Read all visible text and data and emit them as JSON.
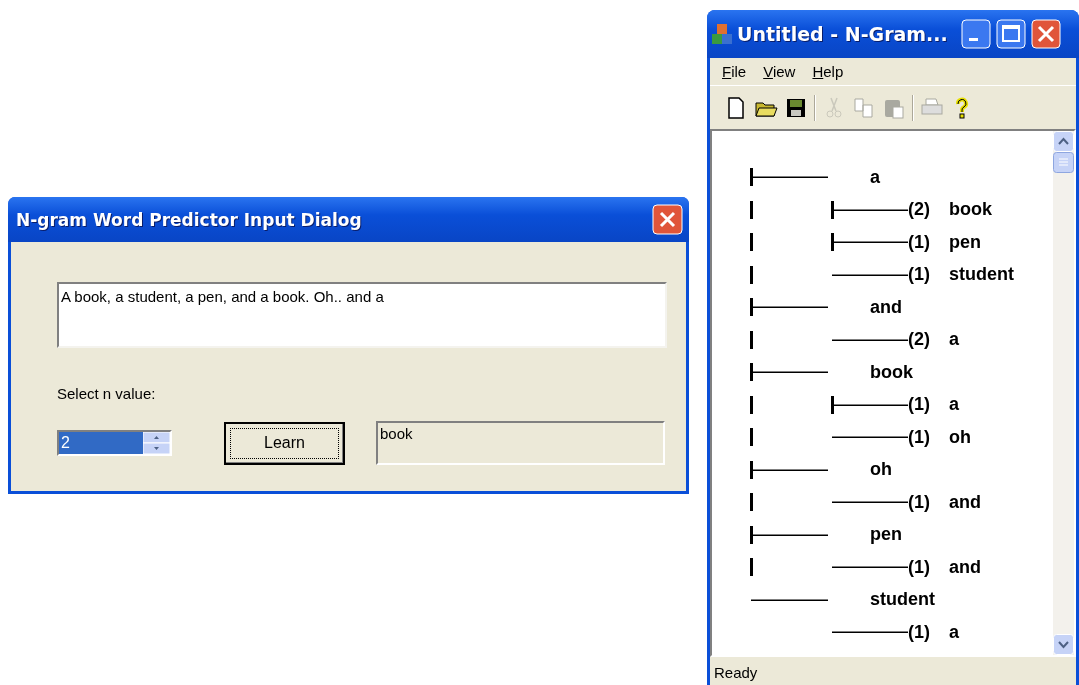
{
  "dialog": {
    "title": "N-gram Word Predictor Input Dialog",
    "text_input": {
      "value": "A book, a student, a pen, and a book.  Oh.. and a"
    },
    "n_label": "Select n value:",
    "n_spin": {
      "value": "2",
      "selected": true
    },
    "learn_button": "Learn",
    "output": "book"
  },
  "main_window": {
    "title": "Untitled - N-Gram...",
    "menu": [
      "File",
      "View",
      "Help"
    ],
    "toolbar": [
      {
        "kind": "new",
        "disabled": false
      },
      {
        "kind": "open",
        "disabled": false
      },
      {
        "kind": "save",
        "disabled": false
      },
      {
        "kind": "separator"
      },
      {
        "kind": "cut",
        "disabled": true
      },
      {
        "kind": "copy",
        "disabled": true
      },
      {
        "kind": "paste",
        "disabled": true
      },
      {
        "kind": "separator"
      },
      {
        "kind": "print",
        "disabled": true
      },
      {
        "kind": "help",
        "disabled": false
      }
    ],
    "tree": [
      {
        "word": "a",
        "children": [
          {
            "count": "(2)",
            "word": "book"
          },
          {
            "count": "(1)",
            "word": "pen"
          },
          {
            "count": "(1)",
            "word": "student"
          }
        ]
      },
      {
        "word": "and",
        "children": [
          {
            "count": "(2)",
            "word": "a"
          }
        ]
      },
      {
        "word": "book",
        "children": [
          {
            "count": "(1)",
            "word": "a"
          },
          {
            "count": "(1)",
            "word": "oh"
          }
        ]
      },
      {
        "word": "oh",
        "children": [
          {
            "count": "(1)",
            "word": "and"
          }
        ]
      },
      {
        "word": "pen",
        "children": [
          {
            "count": "(1)",
            "word": "and"
          }
        ]
      },
      {
        "word": "student",
        "children": [
          {
            "count": "(1)",
            "word": "a"
          }
        ]
      }
    ],
    "status": "Ready"
  }
}
